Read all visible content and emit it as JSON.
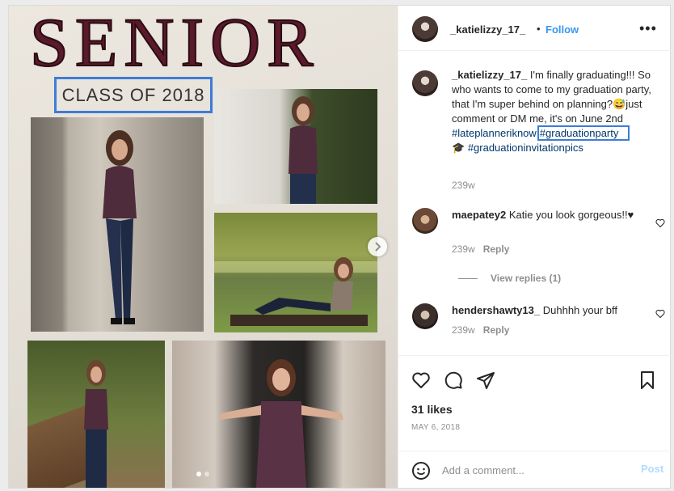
{
  "media": {
    "headline": "SENIOR",
    "subheadline": "CLASS OF 2018"
  },
  "header": {
    "username": "_katielizzy_17_",
    "separator": "•",
    "follow_label": "Follow",
    "more_icon": "more-horizontal-icon"
  },
  "caption": {
    "username": "_katielizzy_17_",
    "text": "I'm finally graduating!!! So who wants to come to my graduation party, that I'm super behind on planning?😅just comment or DM me, it's on June 2nd",
    "tag1": "#lateplanneriknow",
    "tag2": "#graduationparty",
    "emoji": "🎓",
    "tag3": "#graduationinvitationpics",
    "time": "239w"
  },
  "comments": [
    {
      "username": "maepatey2",
      "text": "Katie you look gorgeous!!♥",
      "time": "239w",
      "reply_label": "Reply"
    },
    {
      "username": "hendershawty13_",
      "text": "Duhhhh your bff",
      "time": "239w",
      "reply_label": "Reply"
    }
  ],
  "view_replies": "View replies (1)",
  "likes": "31 likes",
  "date": "MAY 6, 2018",
  "comment_box": {
    "placeholder": "Add a comment...",
    "post_label": "Post"
  },
  "colors": {
    "accent": "#3897f0",
    "highlight_box": "#3d7cd6",
    "post_disabled": "#b3dbff"
  }
}
